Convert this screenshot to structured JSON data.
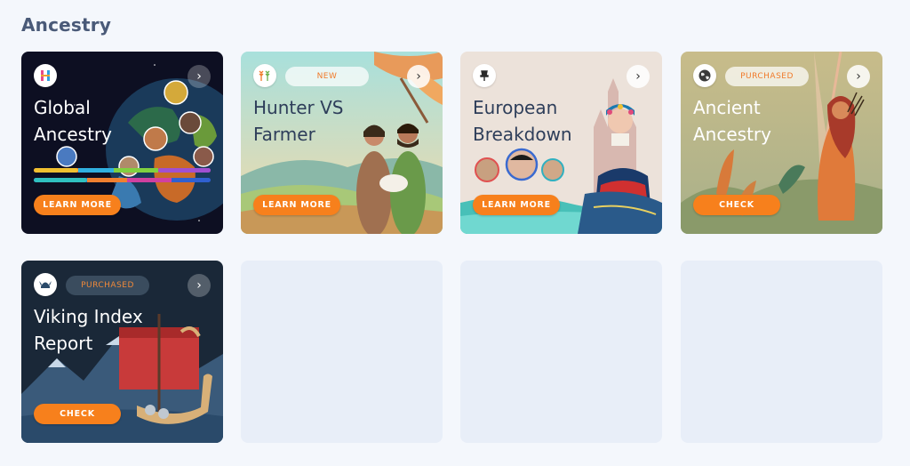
{
  "section": {
    "title": "Ancestry"
  },
  "cards": [
    {
      "title_line1": "Global",
      "title_line2": "Ancestry",
      "button": "LEARN MORE",
      "logo_icon": "h-stripes-icon"
    },
    {
      "title_line1": "Hunter VS",
      "title_line2": "Farmer",
      "badge": "NEW",
      "button": "LEARN MORE",
      "logo_icon": "wheat-icon"
    },
    {
      "title_line1": "European",
      "title_line2": "Breakdown",
      "button": "LEARN MORE",
      "logo_icon": "pin-icon"
    },
    {
      "title_line1": "Ancient",
      "title_line2": "Ancestry",
      "badge": "PURCHASED",
      "button": "CHECK",
      "logo_icon": "globe-icon"
    },
    {
      "title_line1": "Viking Index",
      "title_line2": "Report",
      "badge": "PURCHASED",
      "button": "CHECK",
      "logo_icon": "viking-helmet-icon"
    }
  ],
  "colors": {
    "accent": "#f7801c",
    "placeholder": "#e8eef8",
    "background": "#f4f7fc"
  }
}
